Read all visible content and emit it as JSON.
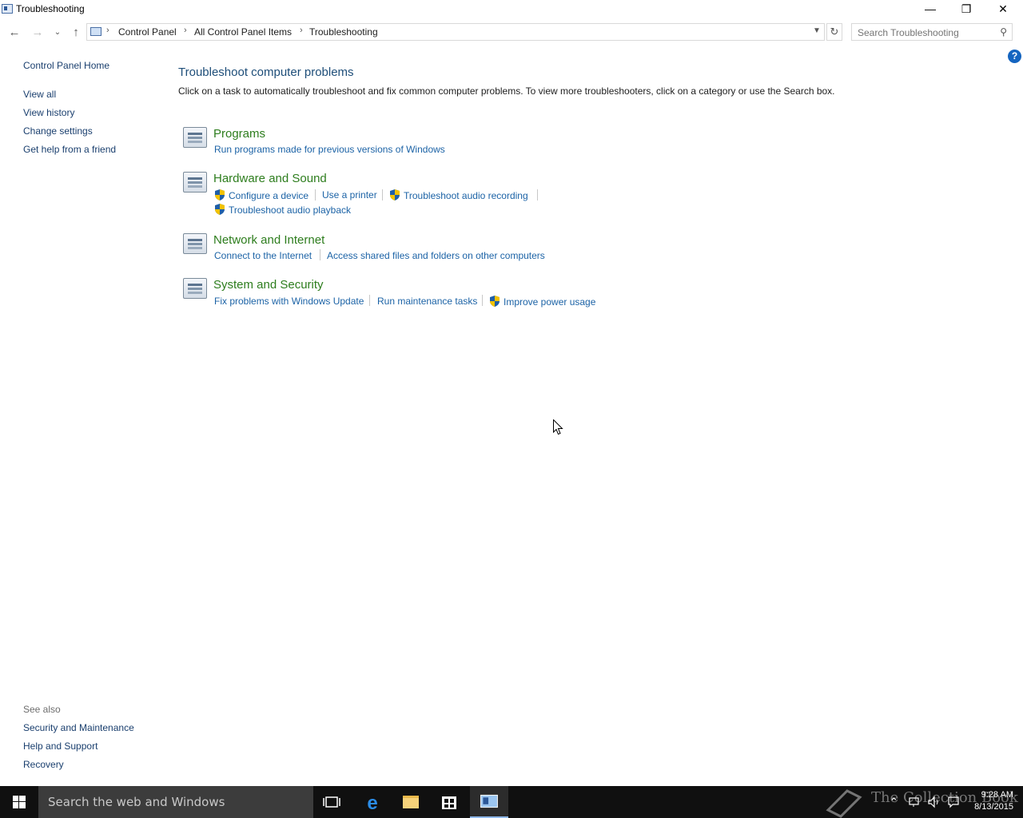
{
  "window": {
    "title": "Troubleshooting"
  },
  "address": {
    "crumbs": [
      "Control Panel",
      "All Control Panel Items",
      "Troubleshooting"
    ],
    "search_placeholder": "Search Troubleshooting"
  },
  "left_nav": {
    "items": [
      "Control Panel Home",
      "View all",
      "View history",
      "Change settings",
      "Get help from a friend"
    ],
    "see_also_label": "See also",
    "see_also": [
      "Security and Maintenance",
      "Help and Support",
      "Recovery"
    ]
  },
  "main": {
    "title": "Troubleshoot computer problems",
    "description": "Click on a task to automatically troubleshoot and fix common computer problems. To view more troubleshooters, click on a category or use the Search box.",
    "categories": [
      {
        "title": "Programs",
        "tasks": [
          "Run programs made for previous versions of Windows"
        ]
      },
      {
        "title": "Hardware and Sound",
        "tasks": [
          "Configure a device",
          "Use a printer",
          "Troubleshoot audio recording",
          "Troubleshoot audio playback"
        ]
      },
      {
        "title": "Network and Internet",
        "tasks": [
          "Connect to the Internet",
          "Access shared files and folders on other computers"
        ]
      },
      {
        "title": "System and Security",
        "tasks": [
          "Fix problems with Windows Update",
          "Run maintenance tasks",
          "Improve power usage"
        ]
      }
    ]
  },
  "taskbar": {
    "search_text": "Search the web and Windows",
    "watermark": "The Collection Book",
    "time": "9:28 AM",
    "date": "8/13/2015"
  },
  "colors": {
    "link": "#1c63a6",
    "category": "#2d7d1d",
    "heading": "#1e4e79",
    "taskbar": "#101010"
  }
}
